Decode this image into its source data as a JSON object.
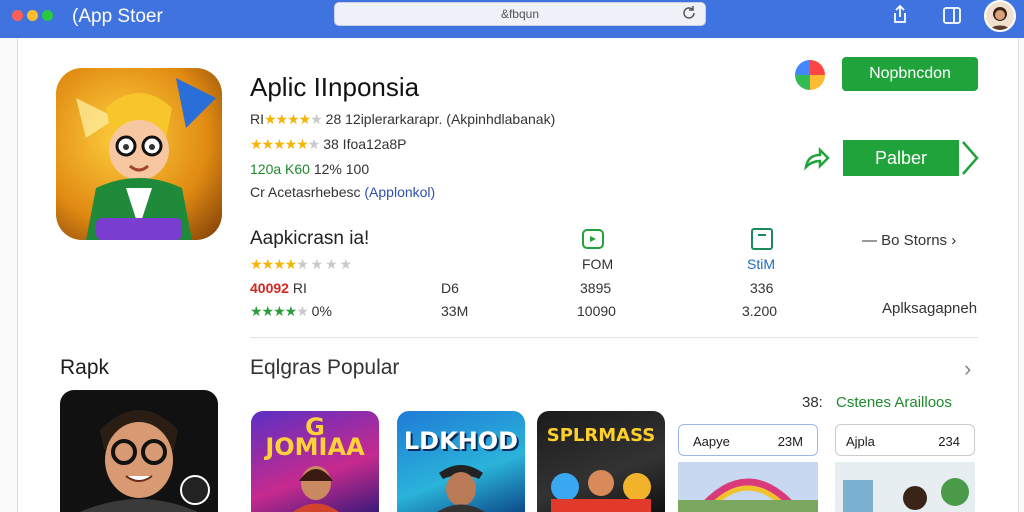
{
  "window": {
    "title": "(App Stoer",
    "url": "&fbqun",
    "dots": [
      "#ff5f57",
      "#febc2e",
      "#28c840"
    ]
  },
  "app": {
    "name": "Aplic IInponsia",
    "rating_line": "28 12iplerarkarapr. (Akpinhdlabanak)",
    "rating_prefix": "RI",
    "rating_line2": "38 Ifoa12a8P",
    "size_line_green": "120a  K60",
    "size_line_rest": "12% 100",
    "dev_line": "Cr Acetasrhebesc",
    "dev_link": "(Applonkol)",
    "primary_button": "Nopbncdon",
    "open_button": "Palber"
  },
  "ratings_section": {
    "title": "Aapkicrasn ia!",
    "icon_a_label": "FOM",
    "icon_b_label": "StiM",
    "see_stores": "Bo Storns",
    "see_stores_symbol": "—",
    "row1": {
      "left_red": "40092",
      "left_rest": "RI",
      "c1": "D6",
      "c2": "3895",
      "c3": "336"
    },
    "row2": {
      "pct": "0%",
      "c1": "33M",
      "c2": "10090",
      "c3": "3.200"
    },
    "right_green": "Aplksagapneh"
  },
  "popular": {
    "side_title": "Rapk",
    "title": "Eqlgras Popular",
    "chevron": "›",
    "count": "38:",
    "category_link": "Cstenes Arailloos",
    "tiles": [
      {
        "label": "G\nJOMIAA"
      },
      {
        "label": "LDKHOD"
      },
      {
        "label": "SPLRMASS"
      }
    ],
    "cards": [
      {
        "name": "Aapye",
        "value": "23M"
      },
      {
        "name": "Ajpla",
        "value": "234"
      }
    ]
  }
}
